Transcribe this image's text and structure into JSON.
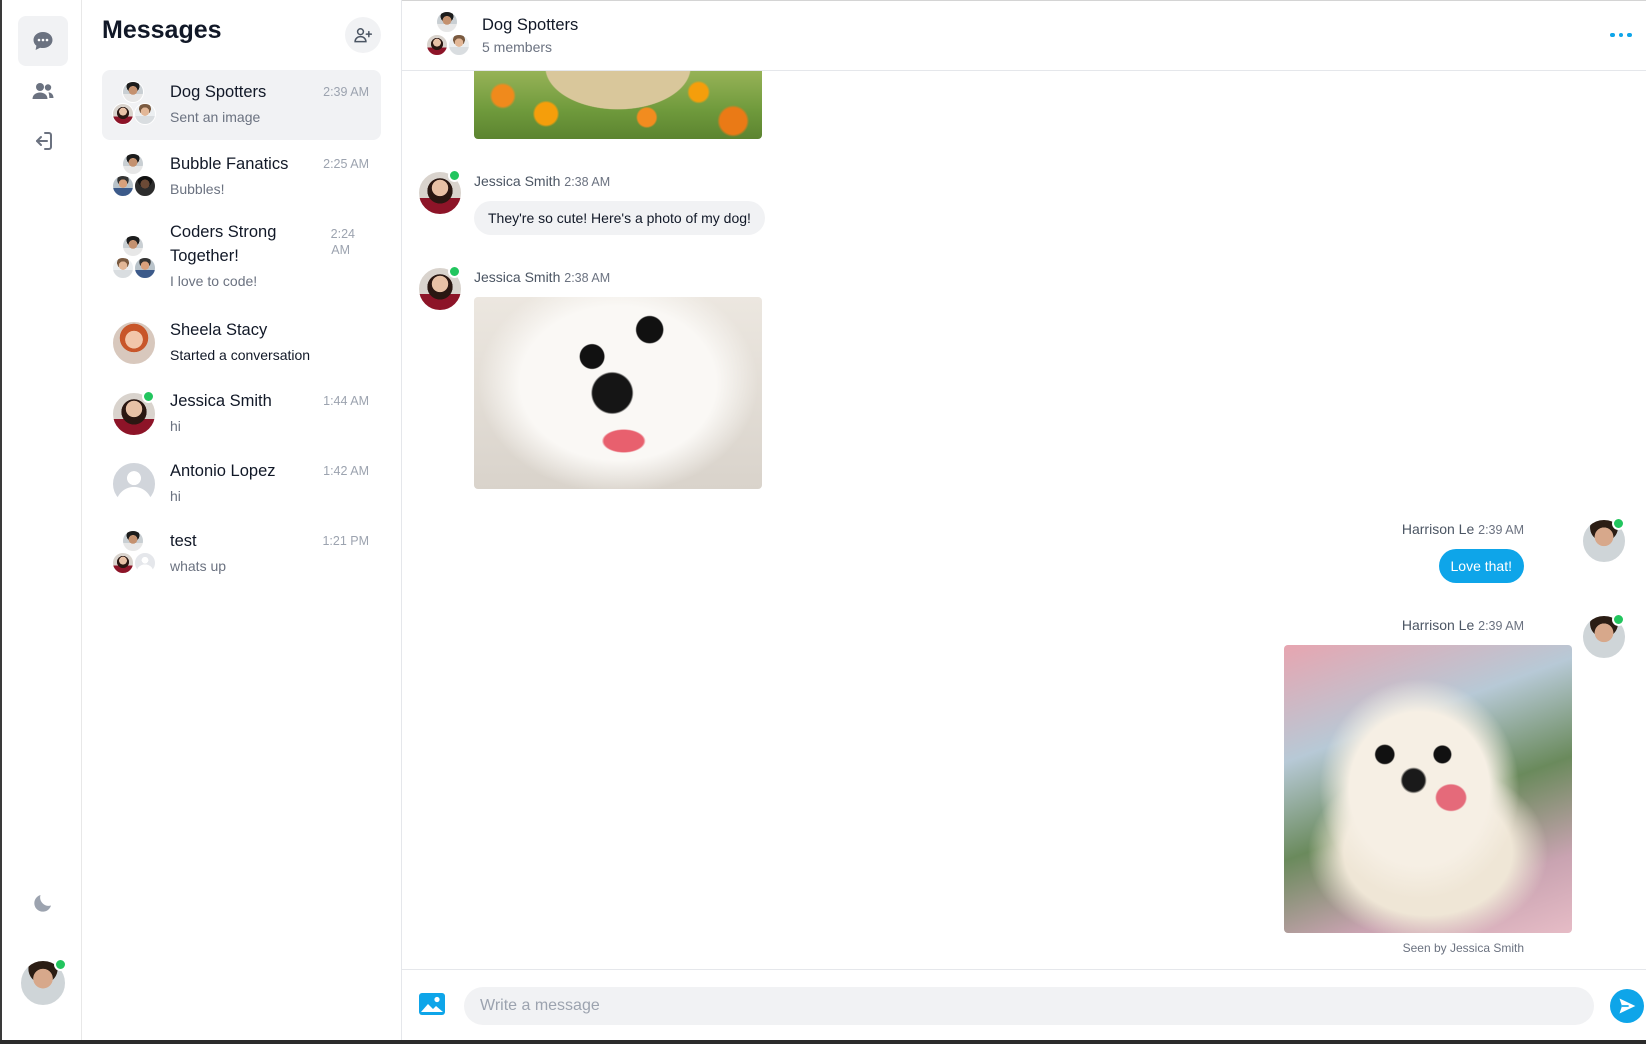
{
  "sidebar": {
    "icons": [
      "chat-bubble-icon",
      "users-icon",
      "logout-icon",
      "moon-icon"
    ],
    "user_online": true
  },
  "list": {
    "title": "Messages",
    "new_chat_icon": "user-plus-icon",
    "conversations": [
      {
        "name": "Dog Spotters",
        "preview": "Sent an image",
        "time": "2:39 AM",
        "active": true,
        "group": true
      },
      {
        "name": "Bubble Fanatics",
        "preview": "Bubbles!",
        "time": "2:25 AM",
        "group": true
      },
      {
        "name": "Coders Strong",
        "name2": "Together!",
        "preview": "I love to code!",
        "time": "2:24",
        "time2": "AM",
        "group": true
      },
      {
        "name": "Sheela Stacy",
        "preview": "Started a conversation",
        "time": "",
        "group": false
      },
      {
        "name": "Jessica Smith",
        "preview": "hi",
        "time": "1:44 AM",
        "online": true,
        "group": false
      },
      {
        "name": "Antonio Lopez",
        "preview": "hi",
        "time": "1:42 AM",
        "group": false
      },
      {
        "name": "test",
        "preview": "whats up",
        "time": "1:21 PM",
        "group": true
      }
    ]
  },
  "chat": {
    "title": "Dog Spotters",
    "subtitle": "5 members",
    "menu_icon": "more-horizontal-icon",
    "messages": [
      {
        "sender": "Jessica Smith",
        "time": "2:38 AM",
        "text": "They're so cute! Here's a photo of my dog!"
      },
      {
        "sender": "Jessica Smith",
        "time": "2:38 AM",
        "image": "pomeranian-photo"
      },
      {
        "sender": "Harrison Le",
        "time": "2:39 AM",
        "text": "Love that!"
      },
      {
        "sender": "Harrison Le",
        "time": "2:39 AM",
        "image": "chihuahua-photo"
      }
    ],
    "seen": "Seen by Jessica Smith"
  },
  "composer": {
    "placeholder": "Write a message",
    "value": "",
    "image_icon": "image-upload-icon",
    "send_icon": "send-icon"
  },
  "colors": {
    "accent": "#0ea5e9",
    "online": "#22c55e",
    "bubble_in": "#f1f2f4"
  }
}
